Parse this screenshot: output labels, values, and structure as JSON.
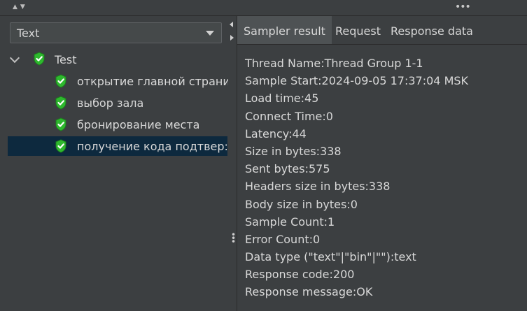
{
  "combo": {
    "value": "Text"
  },
  "tree": {
    "root": {
      "label": "Test"
    },
    "items": [
      {
        "label": "открытие главной страни"
      },
      {
        "label": "выбор зала"
      },
      {
        "label": "бронирование места"
      },
      {
        "label": "получение кода подтвер:"
      }
    ]
  },
  "tabs": [
    {
      "label": "Sampler result"
    },
    {
      "label": "Request"
    },
    {
      "label": "Response data"
    }
  ],
  "sampler": {
    "lines": [
      "Thread Name:Thread Group 1-1",
      "Sample Start:2024-09-05 17:37:04 MSK",
      "Load time:45",
      "Connect Time:0",
      "Latency:44",
      "Size in bytes:338",
      "Sent bytes:575",
      "Headers size in bytes:338",
      "Body size in bytes:0",
      "Sample Count:1",
      "Error Count:0",
      "Data type (\"text\"|\"bin\"|\"\"):text",
      "Response code:200",
      "Response message:OK"
    ]
  },
  "icons": {
    "status": "success-shield-icon",
    "colors": {
      "shield": "#2eb82e",
      "check": "#ffffff",
      "selection": "#0d293e"
    }
  }
}
